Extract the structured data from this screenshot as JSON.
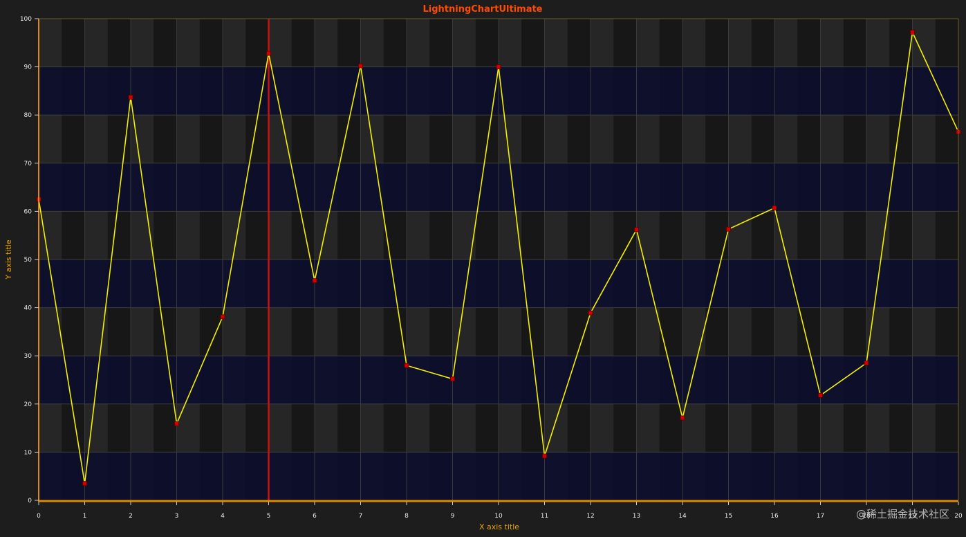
{
  "chart_data": {
    "type": "line",
    "title": "LightningChartUltimate",
    "xlabel": "X axis title",
    "ylabel": "Y axis title",
    "xlim": [
      0,
      20
    ],
    "ylim": [
      0,
      100
    ],
    "x_ticks": [
      0,
      1,
      2,
      3,
      4,
      5,
      6,
      7,
      8,
      9,
      10,
      11,
      12,
      13,
      14,
      15,
      16,
      17,
      18,
      19,
      20
    ],
    "y_ticks": [
      0,
      10,
      20,
      30,
      40,
      50,
      60,
      70,
      80,
      90,
      100
    ],
    "grid": true,
    "series": [
      {
        "x": [
          0,
          1,
          2,
          3,
          4,
          5,
          6,
          7,
          8,
          9,
          10,
          11,
          12,
          13,
          14,
          15,
          16,
          17,
          18,
          19,
          20
        ],
        "values": [
          62.5,
          3.5,
          83.7,
          15.9,
          38.1,
          92.8,
          45.6,
          90.2,
          28.0,
          25.2,
          90.0,
          9.2,
          38.9,
          56.2,
          17.1,
          56.3,
          60.7,
          21.8,
          28.5,
          97.2,
          76.5
        ],
        "line_color": "#f5f000",
        "marker_color": "#d10000"
      }
    ],
    "cursor_x": 5,
    "colors": {
      "background": "#1d1d1d",
      "band_dark": "#141414",
      "band_light": "#262626",
      "band_blue": "#0c0d2e",
      "cursor": "#cc1111",
      "axis": "#e08a00"
    }
  },
  "watermark": "@稀土掘金技术社区"
}
